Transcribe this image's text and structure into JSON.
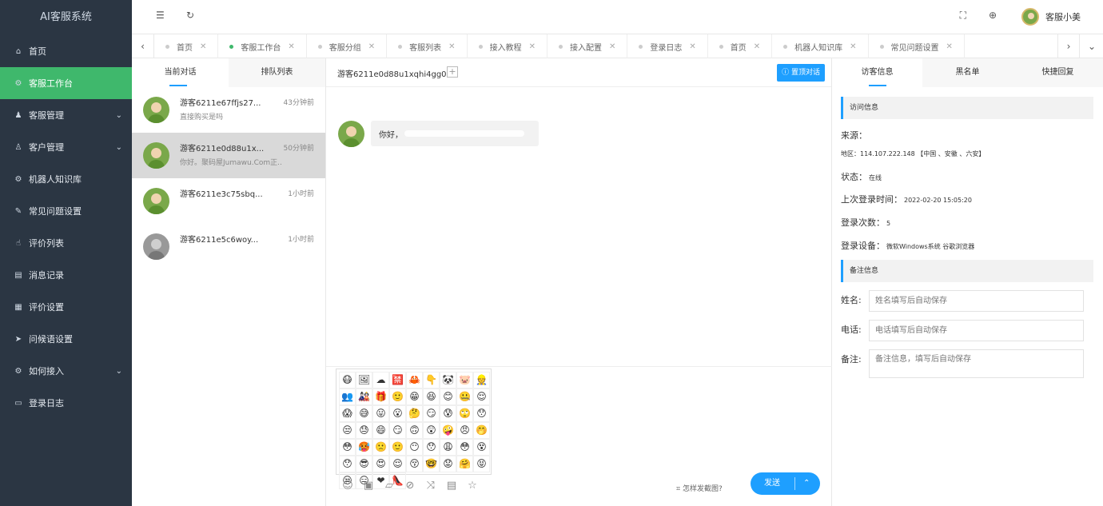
{
  "app": {
    "title": "AI客服系统"
  },
  "sidebar": {
    "items": [
      {
        "label": "首页",
        "icon": "⌂",
        "active": false,
        "expand": false
      },
      {
        "label": "客服工作台",
        "icon": "⚙",
        "active": true,
        "expand": false
      },
      {
        "label": "客服管理",
        "icon": "♟",
        "active": false,
        "expand": true
      },
      {
        "label": "客户管理",
        "icon": "♙",
        "active": false,
        "expand": true
      },
      {
        "label": "机器人知识库",
        "icon": "⚙",
        "active": false,
        "expand": false
      },
      {
        "label": "常见问题设置",
        "icon": "✎",
        "active": false,
        "expand": false
      },
      {
        "label": "评价列表",
        "icon": "☝",
        "active": false,
        "expand": false
      },
      {
        "label": "消息记录",
        "icon": "▤",
        "active": false,
        "expand": false
      },
      {
        "label": "评价设置",
        "icon": "▦",
        "active": false,
        "expand": false
      },
      {
        "label": "问候语设置",
        "icon": "➤",
        "active": false,
        "expand": false
      },
      {
        "label": "如何接入",
        "icon": "⚙",
        "active": false,
        "expand": true
      },
      {
        "label": "登录日志",
        "icon": "▭",
        "active": false,
        "expand": false
      }
    ]
  },
  "header": {
    "user_name": "客服小美",
    "icons": {
      "menu": "☰",
      "refresh": "↻",
      "fullscreen": "⛶",
      "language": "⊕"
    }
  },
  "tabs": [
    {
      "label": "首页",
      "active": false
    },
    {
      "label": "客服工作台",
      "active": true
    },
    {
      "label": "客服分组",
      "active": false
    },
    {
      "label": "客服列表",
      "active": false
    },
    {
      "label": "接入教程",
      "active": false
    },
    {
      "label": "接入配置",
      "active": false
    },
    {
      "label": "登录日志",
      "active": false
    },
    {
      "label": "首页",
      "active": false
    },
    {
      "label": "机器人知识库",
      "active": false
    },
    {
      "label": "常见问题设置",
      "active": false
    }
  ],
  "conversations": {
    "tabs": [
      "当前对话",
      "排队列表"
    ],
    "items": [
      {
        "name": "游客6211e67ffjs27...",
        "time": "43分钟前",
        "preview": "直接购买是吗",
        "active": false,
        "online": true
      },
      {
        "name": "游客6211e0d88u1x...",
        "time": "50分钟前",
        "preview": "你好。聚码屋Jumawu.Com正...",
        "active": true,
        "online": true
      },
      {
        "name": "游客6211e3c75sbq...",
        "time": "1小时前",
        "preview": "",
        "active": false,
        "online": true
      },
      {
        "name": "游客6211e5c6woy...",
        "time": "1小时前",
        "preview": "",
        "active": false,
        "online": false
      }
    ]
  },
  "chat": {
    "title": "游客6211e0d88u1xqhi4gg0",
    "add_icon": "+",
    "top_button": "置顶对话",
    "message": "你好，",
    "emojis": [
      "😷",
      "🖼",
      "☁",
      "🈲",
      "🦀",
      "👇",
      "🐼",
      "🐷",
      "👷",
      "👥",
      "🎎",
      "🎁",
      "🙂",
      "😁",
      "😆",
      "😊",
      "🤐",
      "😌",
      "😱",
      "😅",
      "😛",
      "😮",
      "🤔",
      "😏",
      "😰",
      "🙄",
      "😯",
      "😒",
      "😓",
      "😄",
      "😏",
      "🙃",
      "😲",
      "🤪",
      "😠",
      "🤭",
      "😳",
      "🥵",
      "🙁",
      "🙂",
      "😶",
      "😯",
      "😩",
      "😳",
      "😵",
      "😯",
      "😎",
      "😍",
      "😌",
      "😚",
      "🤓",
      "😟",
      "🤗",
      "😝",
      "😒",
      "😑",
      "❤",
      "👠"
    ],
    "tool_icons": [
      "☺",
      "▣",
      "▱",
      "⊘",
      "⤨",
      "▤",
      "☆"
    ],
    "screenshot_tip": "怎样发截图?",
    "send_label": "发送",
    "send_caret": "⌃"
  },
  "visitor": {
    "tabs": [
      "访客信息",
      "黑名单",
      "快捷回复"
    ],
    "section_visit": "访问信息",
    "source_label": "来源：",
    "region_label": "地区：",
    "region_value": "114.107.222.148 【中国 、安徽 、六安】",
    "status_label": "状态：",
    "status_value": "在线",
    "last_login_label": "上次登录时间：",
    "last_login_value": "2022-02-20 15:05:20",
    "login_count_label": "登录次数：",
    "login_count_value": "5",
    "device_label": "登录设备：",
    "device_value": "微软Windows系统 谷歌浏览器",
    "section_note": "备注信息",
    "name_label": "姓名:",
    "name_placeholder": "姓名填写后自动保存",
    "phone_label": "电话:",
    "phone_placeholder": "电话填写后自动保存",
    "note_label": "备注:",
    "note_placeholder": "备注信息，填写后自动保存"
  },
  "colors": {
    "sidebar_bg": "#2b3643",
    "active_green": "#3fb86c",
    "accent_blue": "#1e9fff"
  }
}
